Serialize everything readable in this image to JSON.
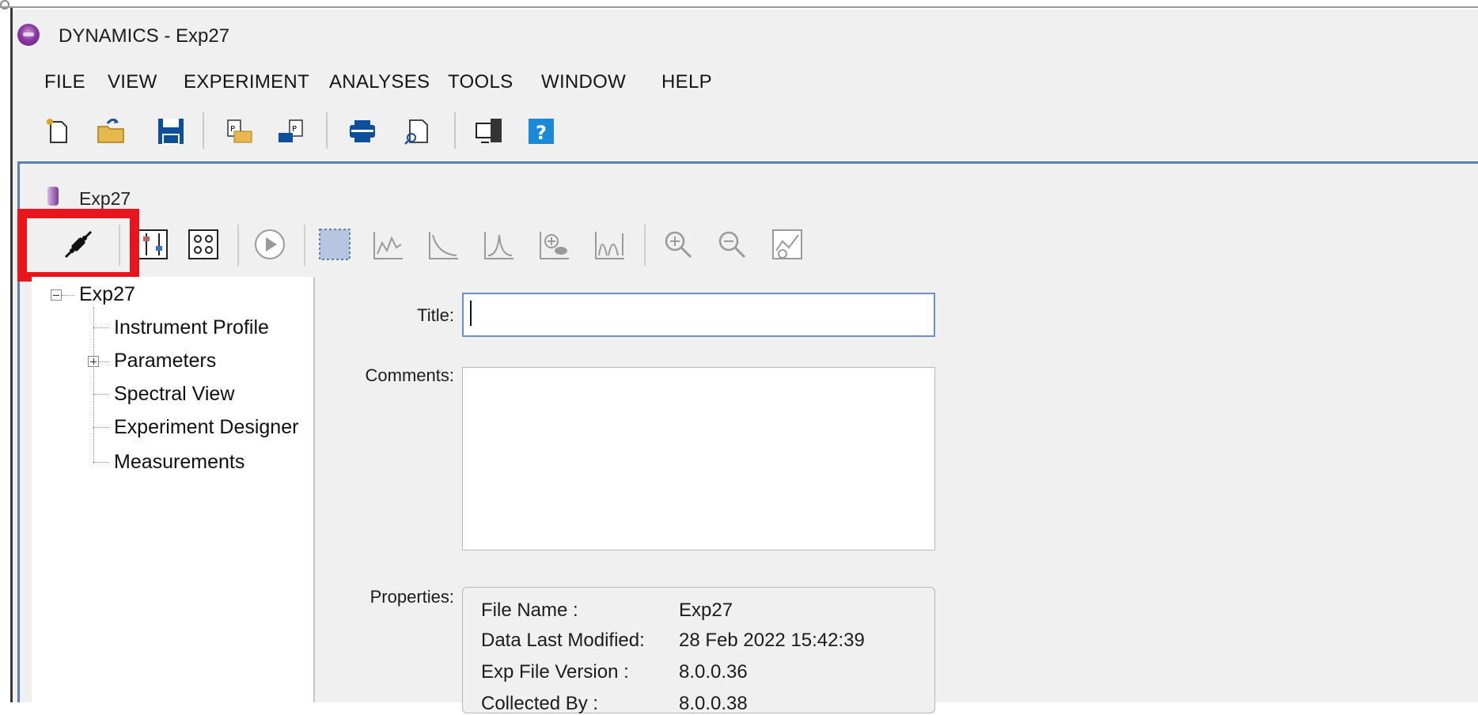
{
  "window": {
    "app_title": "DYNAMICS - Exp27"
  },
  "menu": [
    "FILE",
    "VIEW",
    "EXPERIMENT",
    "ANALYSES",
    "TOOLS",
    "WINDOW",
    "HELP"
  ],
  "toolbar": {
    "icons": [
      "new-file-icon",
      "open-folder-icon",
      "save-icon",
      "export-icon",
      "import-icon",
      "print-icon",
      "print-preview-icon",
      "instrument-window-icon",
      "help-icon"
    ],
    "help_label": "?"
  },
  "document": {
    "title": "Exp27"
  },
  "doc_toolbar": {
    "icons": [
      "connect-plug-icon",
      "sliders-icon",
      "plate-icon",
      "play-icon",
      "select-region-icon",
      "spectrum-icon",
      "decay-icon",
      "peak-icon",
      "add-analysis-icon",
      "distribution-icon",
      "zoom-in-icon",
      "zoom-out-icon",
      "chart-settings-icon"
    ],
    "highlighted": "connect-plug-icon",
    "highlight_color": "#e8161c"
  },
  "tree": {
    "root": "Exp27",
    "items": [
      "Instrument Profile",
      "Parameters",
      "Spectral View",
      "Experiment Designer",
      "Measurements"
    ]
  },
  "form": {
    "title_label": "Title:",
    "title_value": "",
    "comments_label": "Comments:",
    "comments_value": "",
    "properties_label": "Properties:",
    "properties": [
      {
        "key": "File Name :",
        "value": "Exp27"
      },
      {
        "key": "Data Last Modified:",
        "value": "28 Feb 2022 15:42:39"
      },
      {
        "key": "Exp File Version :",
        "value": "8.0.0.36"
      },
      {
        "key": "Collected By :",
        "value": "8.0.0.38"
      }
    ]
  },
  "colors": {
    "accent_blue": "#5a7fb3",
    "highlight_red": "#e8161c",
    "app_purple": "#8a3aa6"
  }
}
